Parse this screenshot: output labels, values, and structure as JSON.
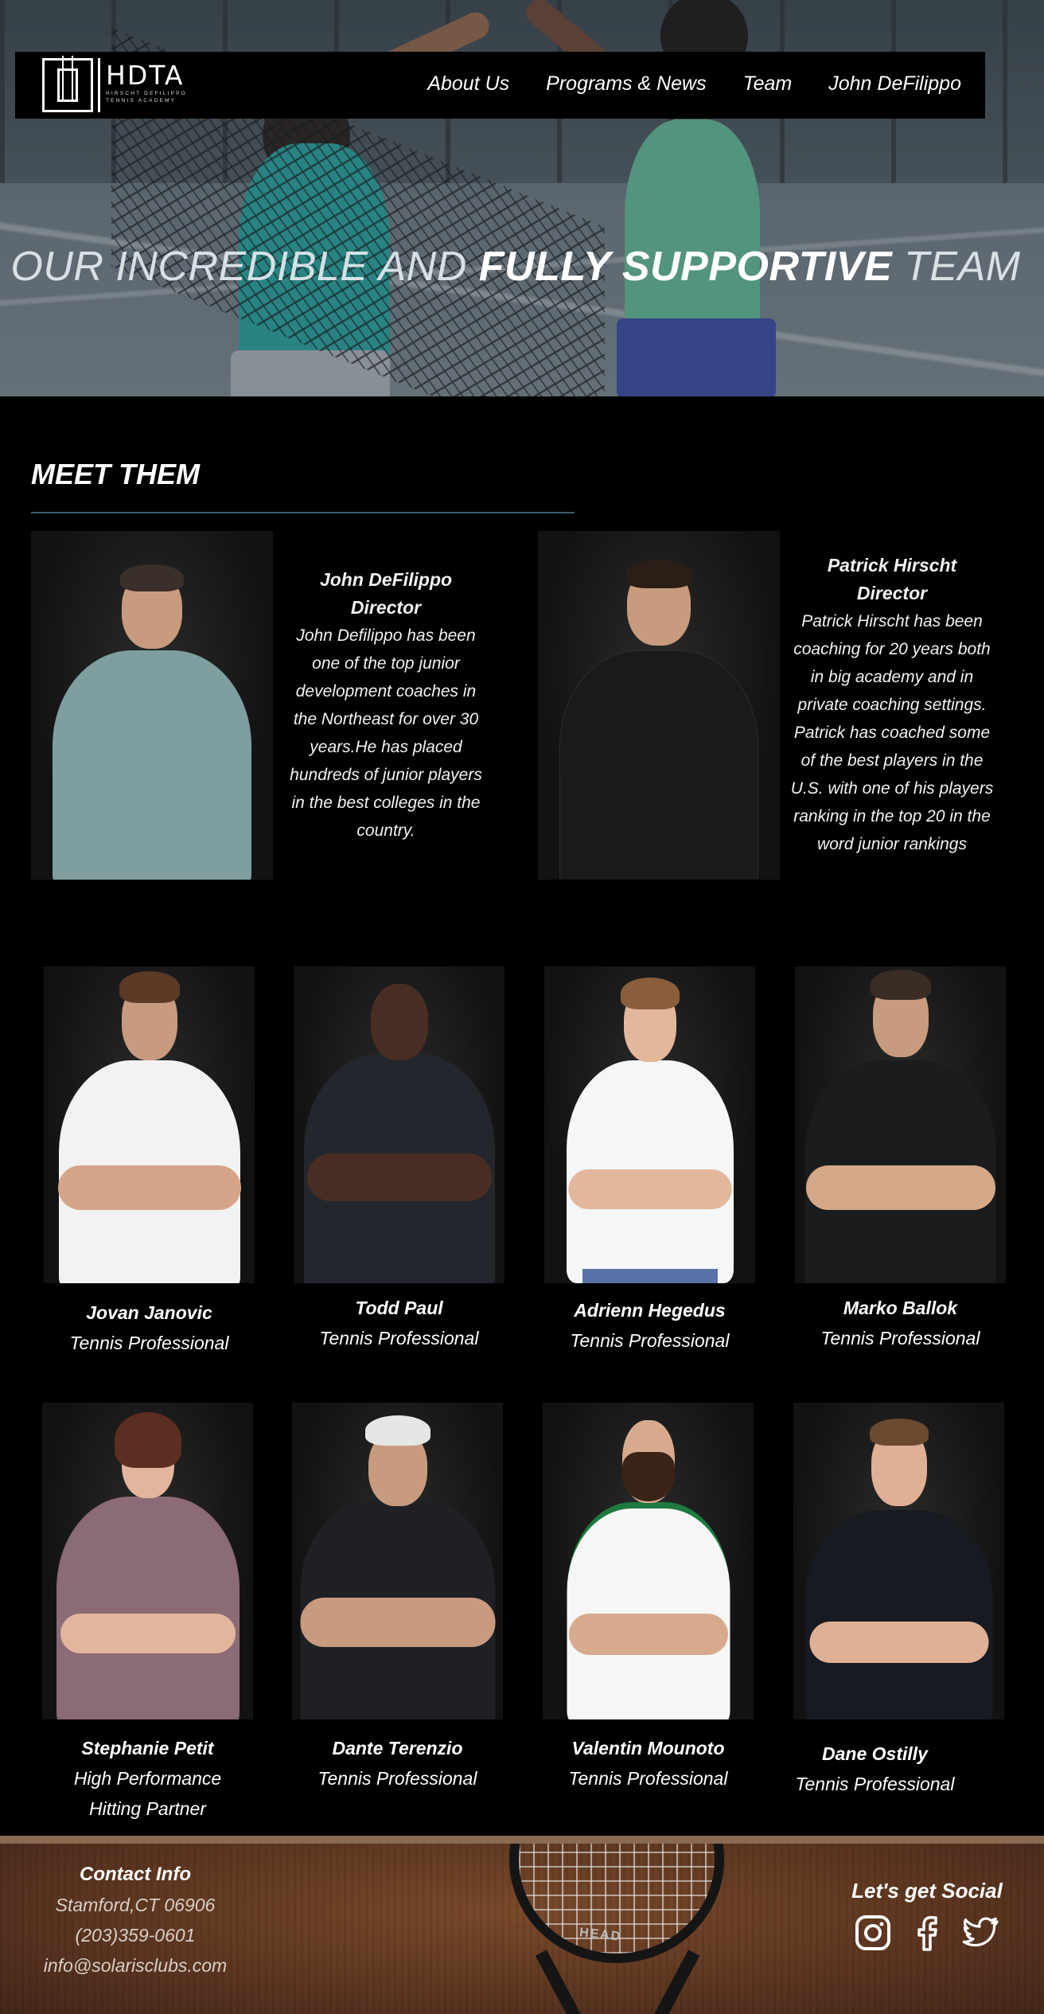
{
  "brand": {
    "name": "HDTA",
    "sub": "HIRSCHT DEFILIPPO TENNIS ACADEMY"
  },
  "nav": {
    "items": [
      {
        "label": "About Us"
      },
      {
        "label": "Programs & News"
      },
      {
        "label": "Team"
      },
      {
        "label": "John DeFilippo"
      }
    ]
  },
  "hero": {
    "title_pre": "OUR INCREDIBLE AND ",
    "title_bold": "FULLY SUPPORTIVE",
    "title_post": " TEAM"
  },
  "section": {
    "title": "MEET THEM"
  },
  "directors": [
    {
      "name": "John DeFilippo",
      "role": "Director",
      "bio": "John Defilippo has been one of the top junior development coaches in the Northeast for over 30 years.He has placed hundreds of junior players in the best colleges in the country."
    },
    {
      "name": "Patrick Hirscht",
      "role": "Director",
      "bio": "Patrick Hirscht has been coaching for 20 years both in big academy and in private coaching settings. Patrick has coached some of the best players in the U.S. with one of his players ranking in the top 20 in the word junior rankings"
    }
  ],
  "staff_row1": [
    {
      "name": "Jovan Janovic",
      "role": "Tennis Professional"
    },
    {
      "name": "Todd Paul",
      "role": "Tennis Professional"
    },
    {
      "name": "Adrienn Hegedus",
      "role": "Tennis Professional"
    },
    {
      "name": "Marko Ballok",
      "role": "Tennis Professional"
    }
  ],
  "staff_row2": [
    {
      "name": "Stephanie Petit",
      "role": "High Performance Hitting Partner"
    },
    {
      "name": "Dante Terenzio",
      "role": "Tennis Professional"
    },
    {
      "name": "Valentin Mounoto",
      "role": "Tennis Professional"
    },
    {
      "name": "Dane Ostilly",
      "role": "Tennis Professional"
    }
  ],
  "footer": {
    "contact_title": "Contact Info",
    "address": "Stamford,CT 06906",
    "phone": "(203)359-0601",
    "email": "info@solarisclubs.com",
    "social_title": "Let's get Social",
    "racket_label": "HEAD",
    "social_icons": [
      "instagram-icon",
      "facebook-icon",
      "twitter-icon"
    ]
  },
  "colors": {
    "background": "#000000",
    "rule": "#3b5f73",
    "footer_brown": "#5b3520"
  }
}
